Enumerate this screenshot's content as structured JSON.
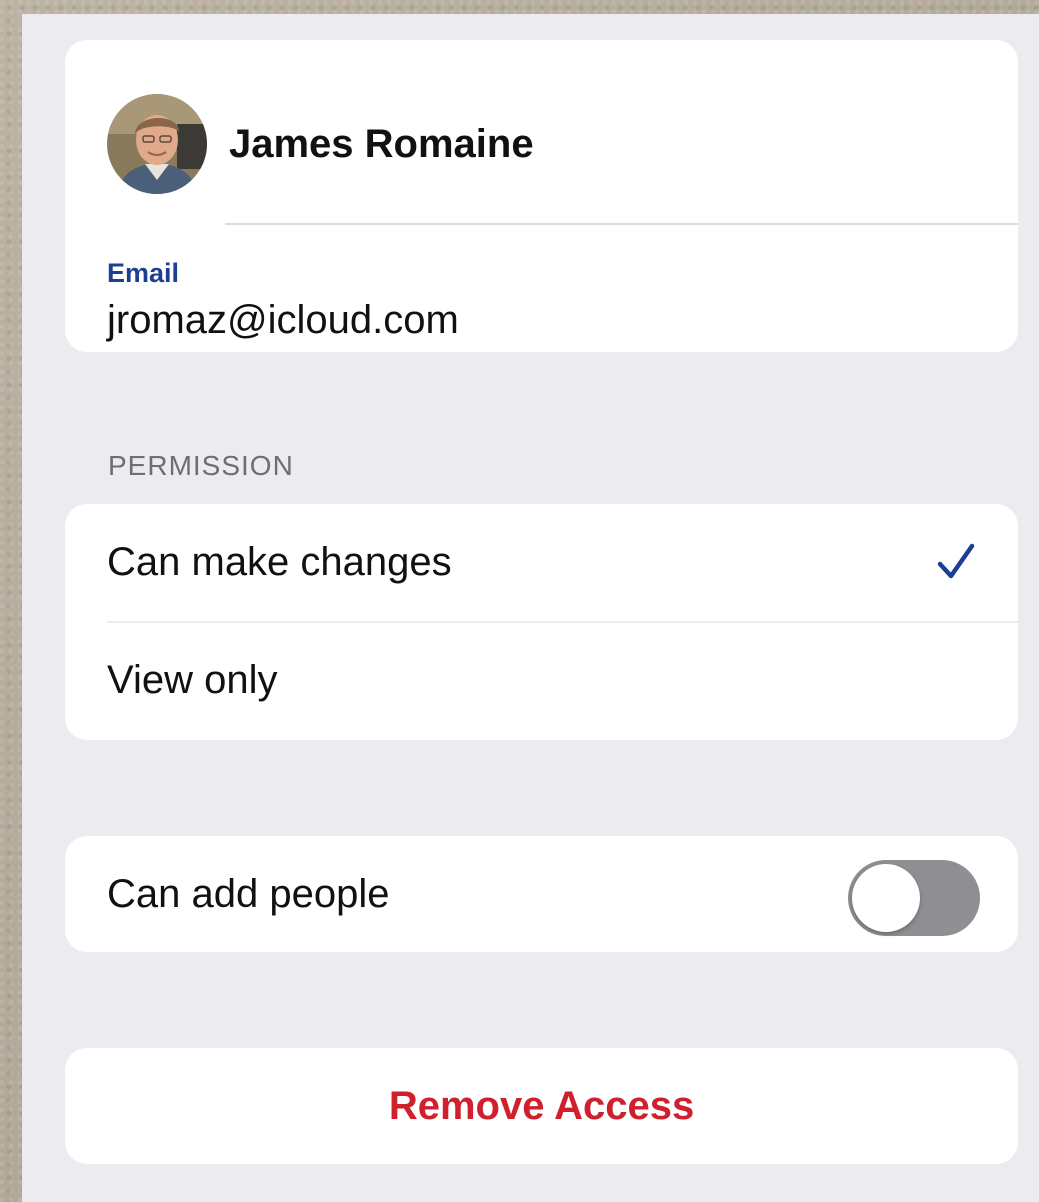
{
  "contact": {
    "name": "James Romaine",
    "email_label": "Email",
    "email_value": "jromaz@icloud.com",
    "avatar_icon": "person-photo-icon"
  },
  "permission": {
    "section_header": "PERMISSION",
    "options": [
      {
        "label": "Can make changes",
        "selected": true
      },
      {
        "label": "View only",
        "selected": false
      }
    ],
    "check_icon": "checkmark-icon"
  },
  "add_people": {
    "label": "Can add people",
    "toggle_on": false
  },
  "remove": {
    "label": "Remove Access"
  },
  "colors": {
    "accent_blue": "#1c3f94",
    "destructive_red": "#d0202e",
    "toggle_off": "#8e8e93",
    "group_background": "#ebebf0"
  }
}
